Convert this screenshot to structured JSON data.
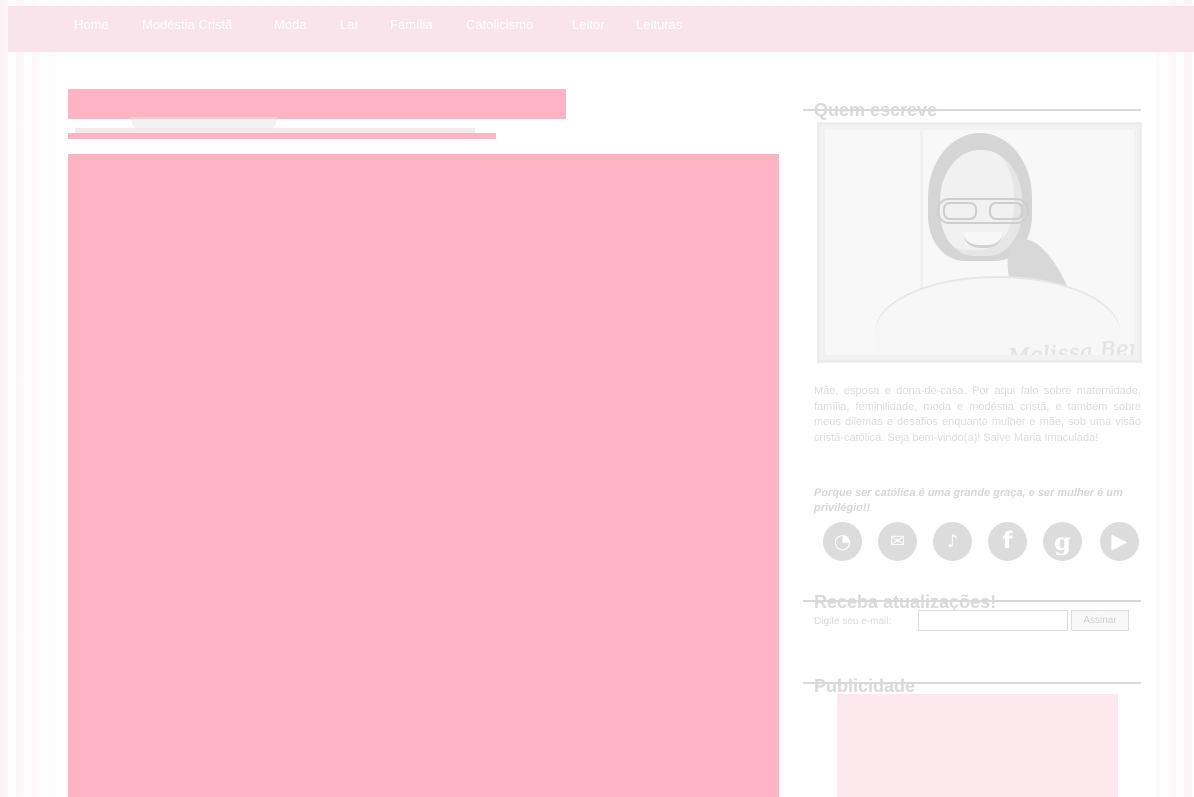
{
  "navigation": {
    "items": [
      {
        "label": "Home"
      },
      {
        "label": "Modéstia Cristã"
      },
      {
        "label": "Moda"
      },
      {
        "label": "Lar"
      },
      {
        "label": "Família"
      },
      {
        "label": "Catolicismo"
      },
      {
        "label": "Leitor"
      },
      {
        "label": "Leituras"
      }
    ]
  },
  "sidebar": {
    "author": {
      "title": "Quem escreve",
      "signature": "Melissa Bergonso",
      "bio": "Mãe, esposa e dona-de-casa. Por aqui falo sobre maternidade, família, feminilidade, moda e modéstia cristã, e também sobre meus dilemas e desafios enquanto mulher e mãe, sob uma visão cristã-católica. Seja bem-vindo(a)! Salve Maria Imaculada!",
      "quote": "Porque ser católica é uma grande graça, e ser mulher é um privilégio!!"
    },
    "social": {
      "icons": [
        {
          "name": "rss-icon",
          "symbol": "◔"
        },
        {
          "name": "mail-icon",
          "symbol": "✉"
        },
        {
          "name": "twitter-icon",
          "symbol": "♪"
        },
        {
          "name": "facebook-icon",
          "symbol": "f"
        },
        {
          "name": "google-icon",
          "symbol": "g"
        },
        {
          "name": "youtube-icon",
          "symbol": "▶"
        }
      ]
    },
    "subscription": {
      "title": "Receba atualizações!",
      "label": "Digite seu e-mail:",
      "email_value": "",
      "button_label": "Assinar"
    },
    "advertising": {
      "title": "Publicidade"
    }
  },
  "colors": {
    "masked_area": "#ffb4c4",
    "navigation_background": "#f8e4ea",
    "sidebar_text": "#dcdcdc",
    "advertising_background": "#fde8ee"
  }
}
